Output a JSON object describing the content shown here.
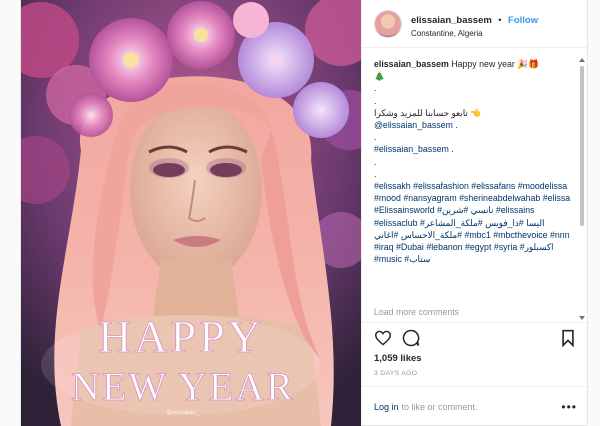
{
  "post": {
    "username": "elissaian_bassem",
    "follow_label": "Follow",
    "separator": "•",
    "location": "Constantine, Algeria"
  },
  "photo": {
    "headline_line1": "HAPPY",
    "headline_line2": "NEW YEAR",
    "watermark": "@elissaian_"
  },
  "caption": {
    "author": "elissaian_bassem",
    "text": "Happy new year 🎉🎁",
    "emoji_line": "🎄",
    "dot": ".",
    "arabic_line": "👈 تابعو حسابنا للمزيد وشكرا",
    "mention": "@elissaian_bassem .",
    "hashtag_self": "#elissaian_bassem .",
    "hashtags": "#elissakh #elissafashion #elissafans #moodelissa #mood #nansyagram #sherineabdelwahab #elissa #Elissainsworld #نانسي #شرين #elissains #elissaclub #اليسا #ذا_فويس #ملكة_المشاعر #ملكة_الاحساس #اغاني #mbc1 #mbcthevoice #nnn #iraq #Dubai #lebanon #egypt #syria #اكسبلور #music #ستاب"
  },
  "load_more": "Load more comments",
  "likes": "1,059 likes",
  "time_ago": "3 DAYS AGO",
  "login": {
    "link": "Log in",
    "text": "to like or comment.",
    "more_icon": "•••"
  },
  "icons": [
    "heart-icon",
    "comment-icon",
    "bookmark-icon"
  ],
  "colors": {
    "link": "#3897f0",
    "tag": "#003569",
    "muted": "#999999"
  }
}
